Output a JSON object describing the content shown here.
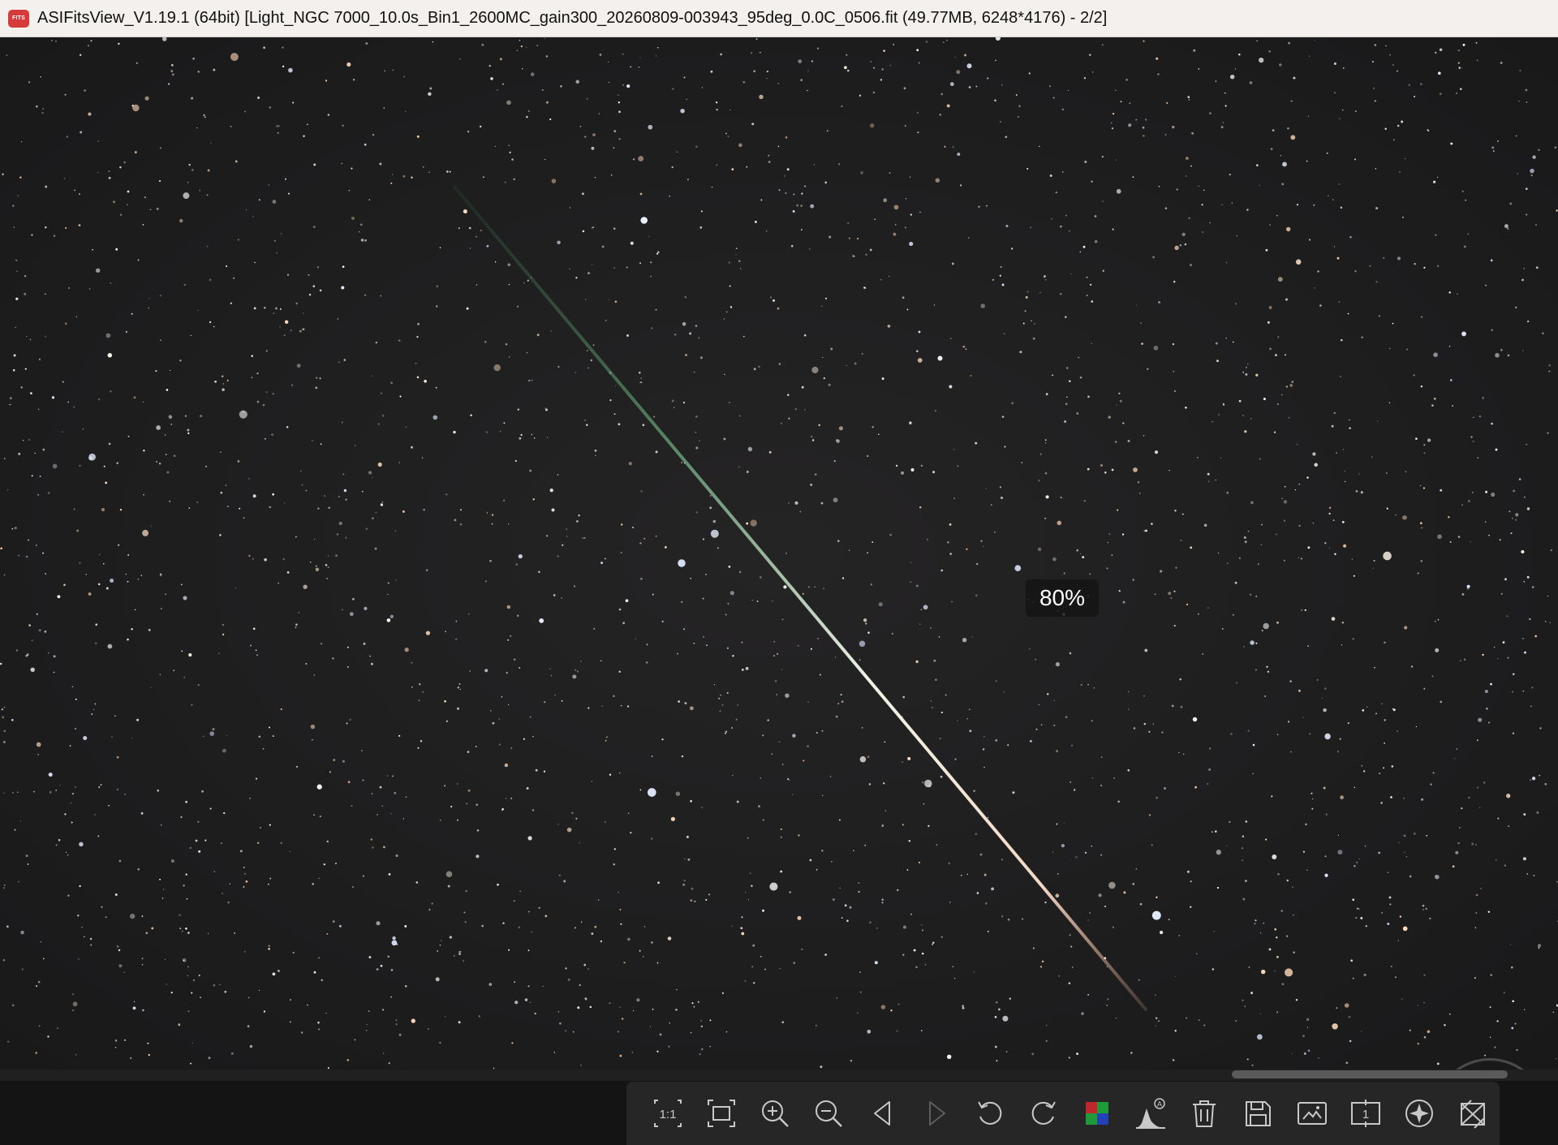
{
  "window": {
    "app_icon_text": "FITS",
    "title": "ASIFitsView_V1.19.1 (64bit) [Light_NGC 7000_10.0s_Bin1_2600MC_gain300_20260809-003943_95deg_0.0C_0506.fit (49.77MB, 6248*4176) - 2/2]"
  },
  "viewer": {
    "zoom_label": "80%"
  },
  "toolbar": {
    "items": [
      {
        "icon": "actual-size-icon",
        "label": "1:1"
      },
      {
        "icon": "fit-window-icon"
      },
      {
        "icon": "zoom-in-icon"
      },
      {
        "icon": "zoom-out-icon"
      },
      {
        "icon": "previous-icon"
      },
      {
        "icon": "next-icon",
        "enabled": false
      },
      {
        "icon": "rotate-left-icon"
      },
      {
        "icon": "rotate-right-icon"
      },
      {
        "icon": "debayer-icon"
      },
      {
        "icon": "auto-stretch-histogram-icon",
        "label": "A"
      },
      {
        "icon": "delete-icon"
      },
      {
        "icon": "save-icon"
      },
      {
        "icon": "image-adjust-icon"
      },
      {
        "icon": "info-icon",
        "label": "1"
      },
      {
        "icon": "star-detect-icon"
      },
      {
        "icon": "crop-icon"
      }
    ]
  },
  "colors": {
    "sky": "#1d1d1e",
    "toolbar": "#262626",
    "titlebar": "#f3f0ed",
    "app_icon": "#d63a3a",
    "icon": "#c8c8c8"
  }
}
